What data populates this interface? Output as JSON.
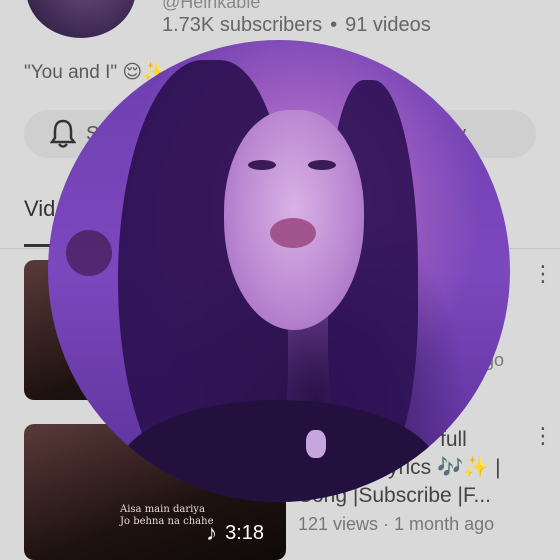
{
  "channel": {
    "name_fragment": "@Heinkable",
    "subscribers": "1.73K subscribers",
    "separator": "•",
    "videos_count": "91 videos",
    "description": "\"You and I\" 😌✨"
  },
  "actions": {
    "subscribe_label": "S",
    "community_label": "ity"
  },
  "tabs": {
    "videos_label": "Vid"
  },
  "videos": [
    {
      "title_fragment": "o",
      "meta_fragment": "go"
    },
    {
      "title_line1": "full",
      "title_line2": "yrics 🎶✨ |",
      "title_line3": "Song |Subscribe |F...",
      "meta": "121 views · 1 month ago",
      "thumb_caption_1": "Aisa main dariya",
      "thumb_caption_2": "Jo behna na chahe",
      "duration": "3:18"
    }
  ],
  "icons": {
    "bell": "bell-icon",
    "music_note": "music-note-icon",
    "kebab": "more-vert-icon"
  },
  "colors": {
    "overlay_purple": "#7b48bd",
    "background": "#d9d9d9"
  }
}
